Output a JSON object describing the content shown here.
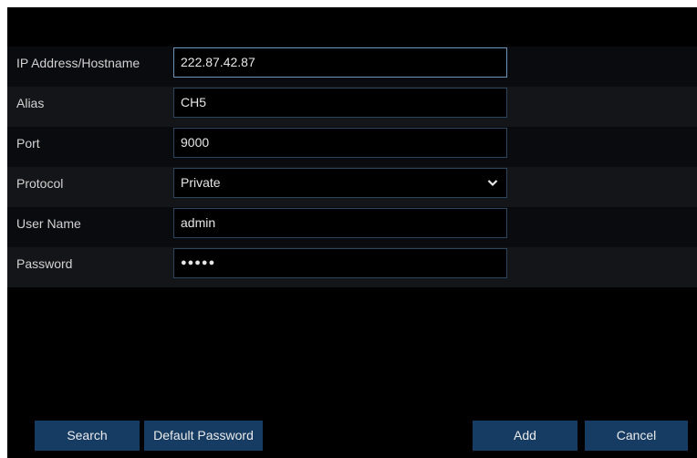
{
  "form": {
    "fields": [
      {
        "label": "IP Address/Hostname",
        "value": "222.87.42.87"
      },
      {
        "label": "Alias",
        "value": "CH5"
      },
      {
        "label": "Port",
        "value": "9000"
      },
      {
        "label": "Protocol",
        "value": "Private"
      },
      {
        "label": "User Name",
        "value": "admin"
      },
      {
        "label": "Password",
        "value": "●●●●●"
      }
    ]
  },
  "buttons": {
    "search": "Search",
    "default_password": "Default Password",
    "add": "Add",
    "cancel": "Cancel"
  },
  "icons": {
    "protocol_dropdown": "chevron-down-icon"
  },
  "colors": {
    "background": "#000000",
    "button": "#163c63",
    "field_border": "#2c4660",
    "active_border": "#6d93b8"
  }
}
